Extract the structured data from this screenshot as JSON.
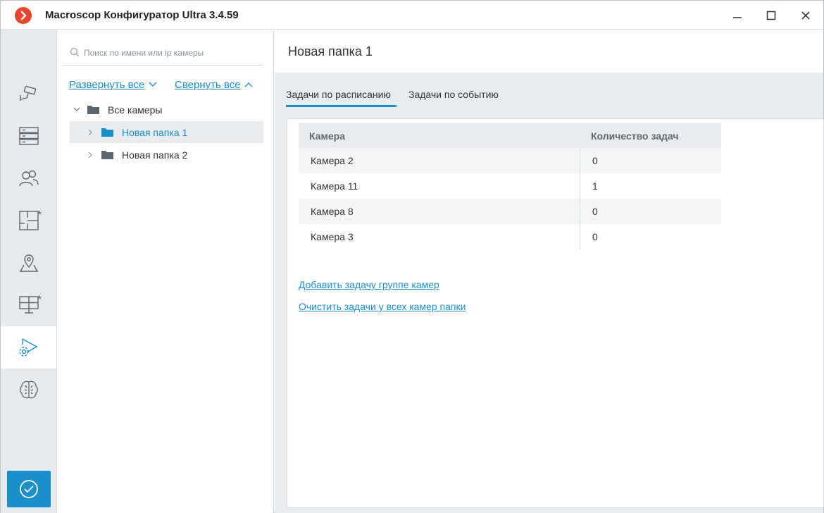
{
  "app": {
    "title": "Macroscop Конфигуратор Ultra 3.4.59",
    "colors": {
      "accent": "#1a8fc9",
      "logo": "#e8452c",
      "rail_bg": "#e6eaed"
    }
  },
  "window_controls": [
    "minimize-icon",
    "maximize-icon",
    "close-icon"
  ],
  "rail": {
    "items": [
      {
        "icon": "camera-icon",
        "marker": ""
      },
      {
        "icon": "server-icon",
        "marker": ""
      },
      {
        "icon": "users-icon",
        "marker": ""
      },
      {
        "icon": "floor-plan-icon",
        "marker": "*"
      },
      {
        "icon": "map-pin-icon",
        "marker": ""
      },
      {
        "icon": "monitor-icon",
        "marker": "*"
      },
      {
        "icon": "play-gear-icon",
        "marker": "",
        "active": true
      },
      {
        "icon": "brain-icon",
        "marker": ""
      }
    ],
    "apply_icon": "checkmark-circle-icon"
  },
  "tree": {
    "search_placeholder": "Поиск по имени или ip камеры",
    "expand_all": "Развернуть все",
    "collapse_all": "Свернуть все",
    "items": [
      {
        "label": "Все камеры",
        "expanded": true
      },
      {
        "label": "Новая папка 1",
        "selected": true
      },
      {
        "label": "Новая папка 2"
      }
    ]
  },
  "main": {
    "title": "Новая папка 1",
    "tabs": [
      {
        "label": "Задачи по расписанию",
        "active": true
      },
      {
        "label": "Задачи по событию"
      }
    ],
    "table": {
      "headers": [
        "Камера",
        "Количество задач"
      ],
      "rows": [
        [
          "Камера 2",
          "0"
        ],
        [
          "Камера 11",
          "1"
        ],
        [
          "Камера 8",
          "0"
        ],
        [
          "Камера 3",
          "0"
        ]
      ]
    },
    "links": {
      "add_task": "Добавить задачу группе камер",
      "clear_tasks": "Очистить задачи у всех камер папки"
    }
  }
}
